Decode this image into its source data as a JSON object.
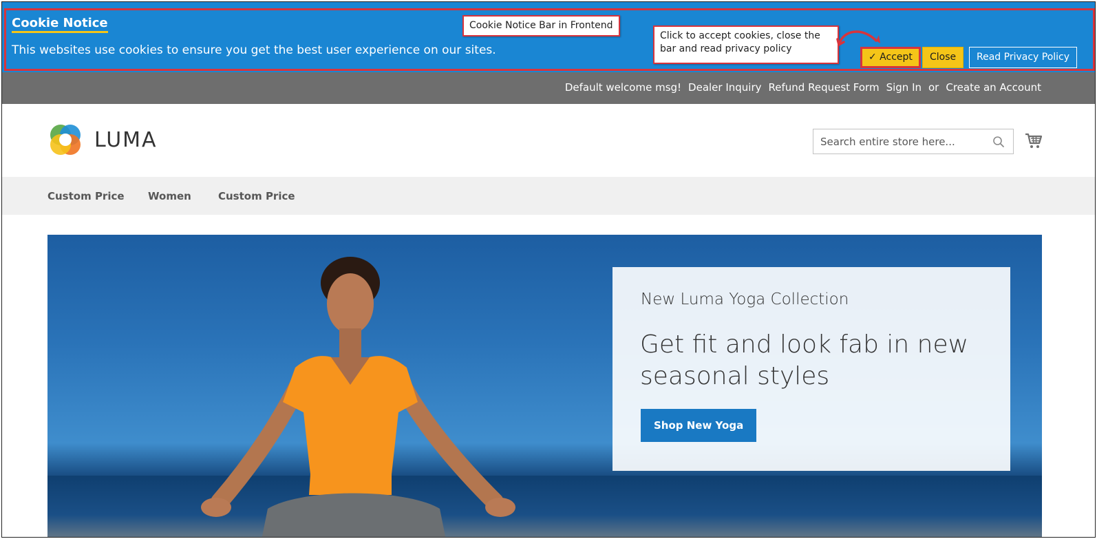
{
  "cookie_bar": {
    "title": "Cookie Notice",
    "message": "This websites use cookies to ensure you get the best user experience on our sites.",
    "accept_label": "✓ Accept",
    "close_label": "Close",
    "policy_label": "Read Privacy Policy"
  },
  "annotations": {
    "bar_label": "Cookie Notice Bar in Frontend",
    "buttons_note_line1": "Click to accept cookies, close the",
    "buttons_note_line2": "bar and read privacy policy"
  },
  "header_links": {
    "welcome": "Default welcome msg!",
    "dealer": "Dealer Inquiry",
    "refund": "Refund Request Form",
    "sign_in": "Sign In",
    "or": "or",
    "create_account": "Create an Account"
  },
  "logo": {
    "text": "LUMA"
  },
  "search": {
    "placeholder": "Search entire store here..."
  },
  "nav": {
    "items": [
      {
        "label": "Custom Price"
      },
      {
        "label": "Women"
      },
      {
        "label": "Custom Price"
      }
    ]
  },
  "hero": {
    "subtitle": "New Luma Yoga Collection",
    "title": "Get fit and look fab in new seasonal styles",
    "button": "Shop New Yoga"
  },
  "colors": {
    "cookie_bar_bg": "#1a86d3",
    "accept_bg": "#f5c518",
    "header_bg": "#6e6e6e",
    "nav_bg": "#f0f0f0",
    "primary_button": "#1979c3",
    "annotation_border": "#d8343c"
  },
  "icons": [
    "luma-logo-icon",
    "search-icon",
    "cart-icon",
    "annotation-arrow-icon"
  ]
}
